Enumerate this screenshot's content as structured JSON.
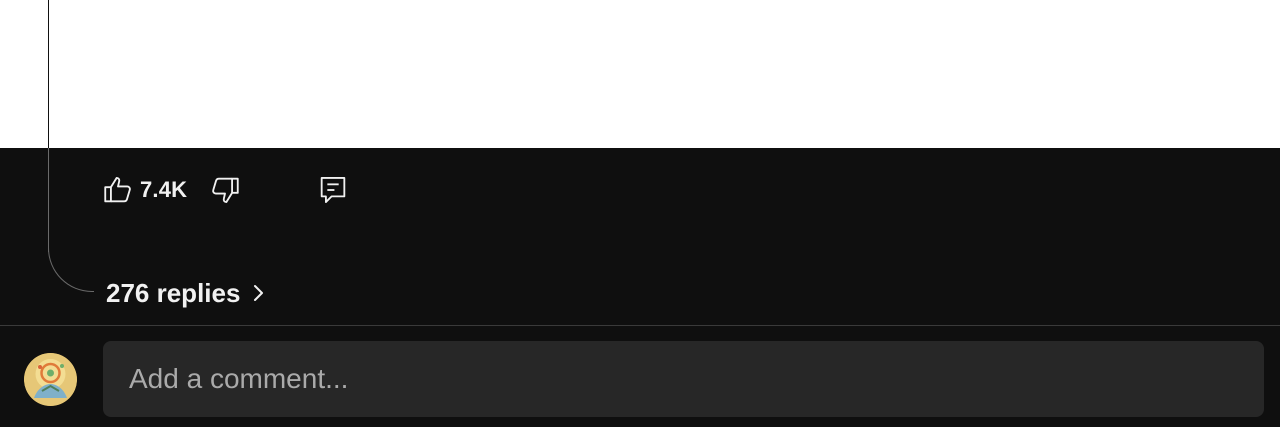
{
  "comment": {
    "like_count": "7.4K",
    "replies_label": "276 replies"
  },
  "composer": {
    "placeholder": "Add a comment..."
  },
  "icons": {
    "like": "thumbs-up-icon",
    "dislike": "thumbs-down-icon",
    "reply": "reply-icon",
    "chevron": "chevron-right-icon",
    "avatar": "user-avatar"
  },
  "colors": {
    "background": "#0f0f0f",
    "text": "#f1f1f1",
    "input_background": "#272727",
    "placeholder": "#aaaaaa"
  }
}
